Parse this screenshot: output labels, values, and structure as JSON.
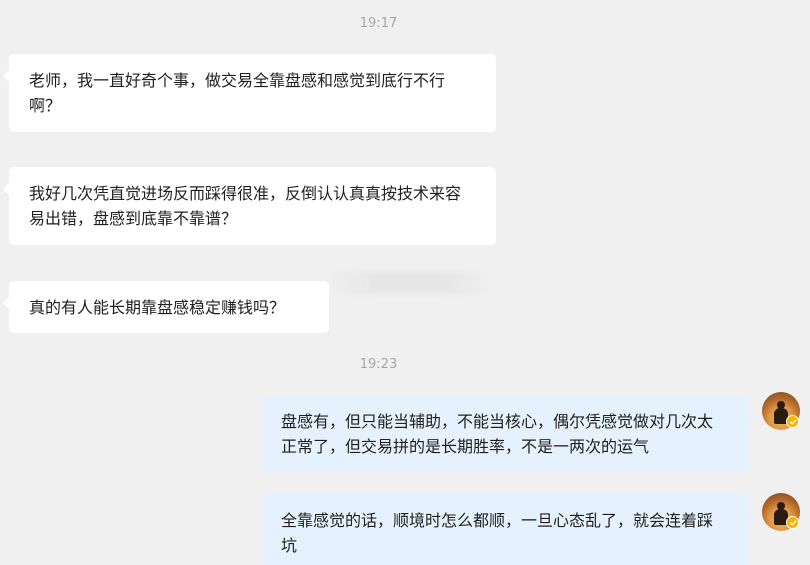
{
  "chat": {
    "timestamps": [
      "19:17",
      "19:23"
    ],
    "incoming": [
      "老师，我一直好奇个事，做交易全靠盘感和感觉到底行不行啊？",
      "我好几次凭直觉进场反而踩得很准，反倒认认真真按技术来容易出错，盘感到底靠不靠谱？",
      "真的有人能长期靠盘感稳定赚钱吗？"
    ],
    "outgoing": [
      "盘感有，但只能当辅助，不能当核心，偶尔凭感觉做对几次太正常了，但交易拼的是长期胜率，不是一两次的运气",
      "全靠感觉的话，顺境时怎么都顺，一旦心态乱了，就会连着踩坑"
    ]
  },
  "icons": {
    "avatar": "user-avatar-icon",
    "badge": "verified-badge-icon"
  },
  "colors": {
    "background": "#f0f0f0",
    "incoming_bubble": "#ffffff",
    "outgoing_bubble": "#e5f2fd",
    "timestamp": "#a6a6a6",
    "badge": "#f5b400"
  }
}
